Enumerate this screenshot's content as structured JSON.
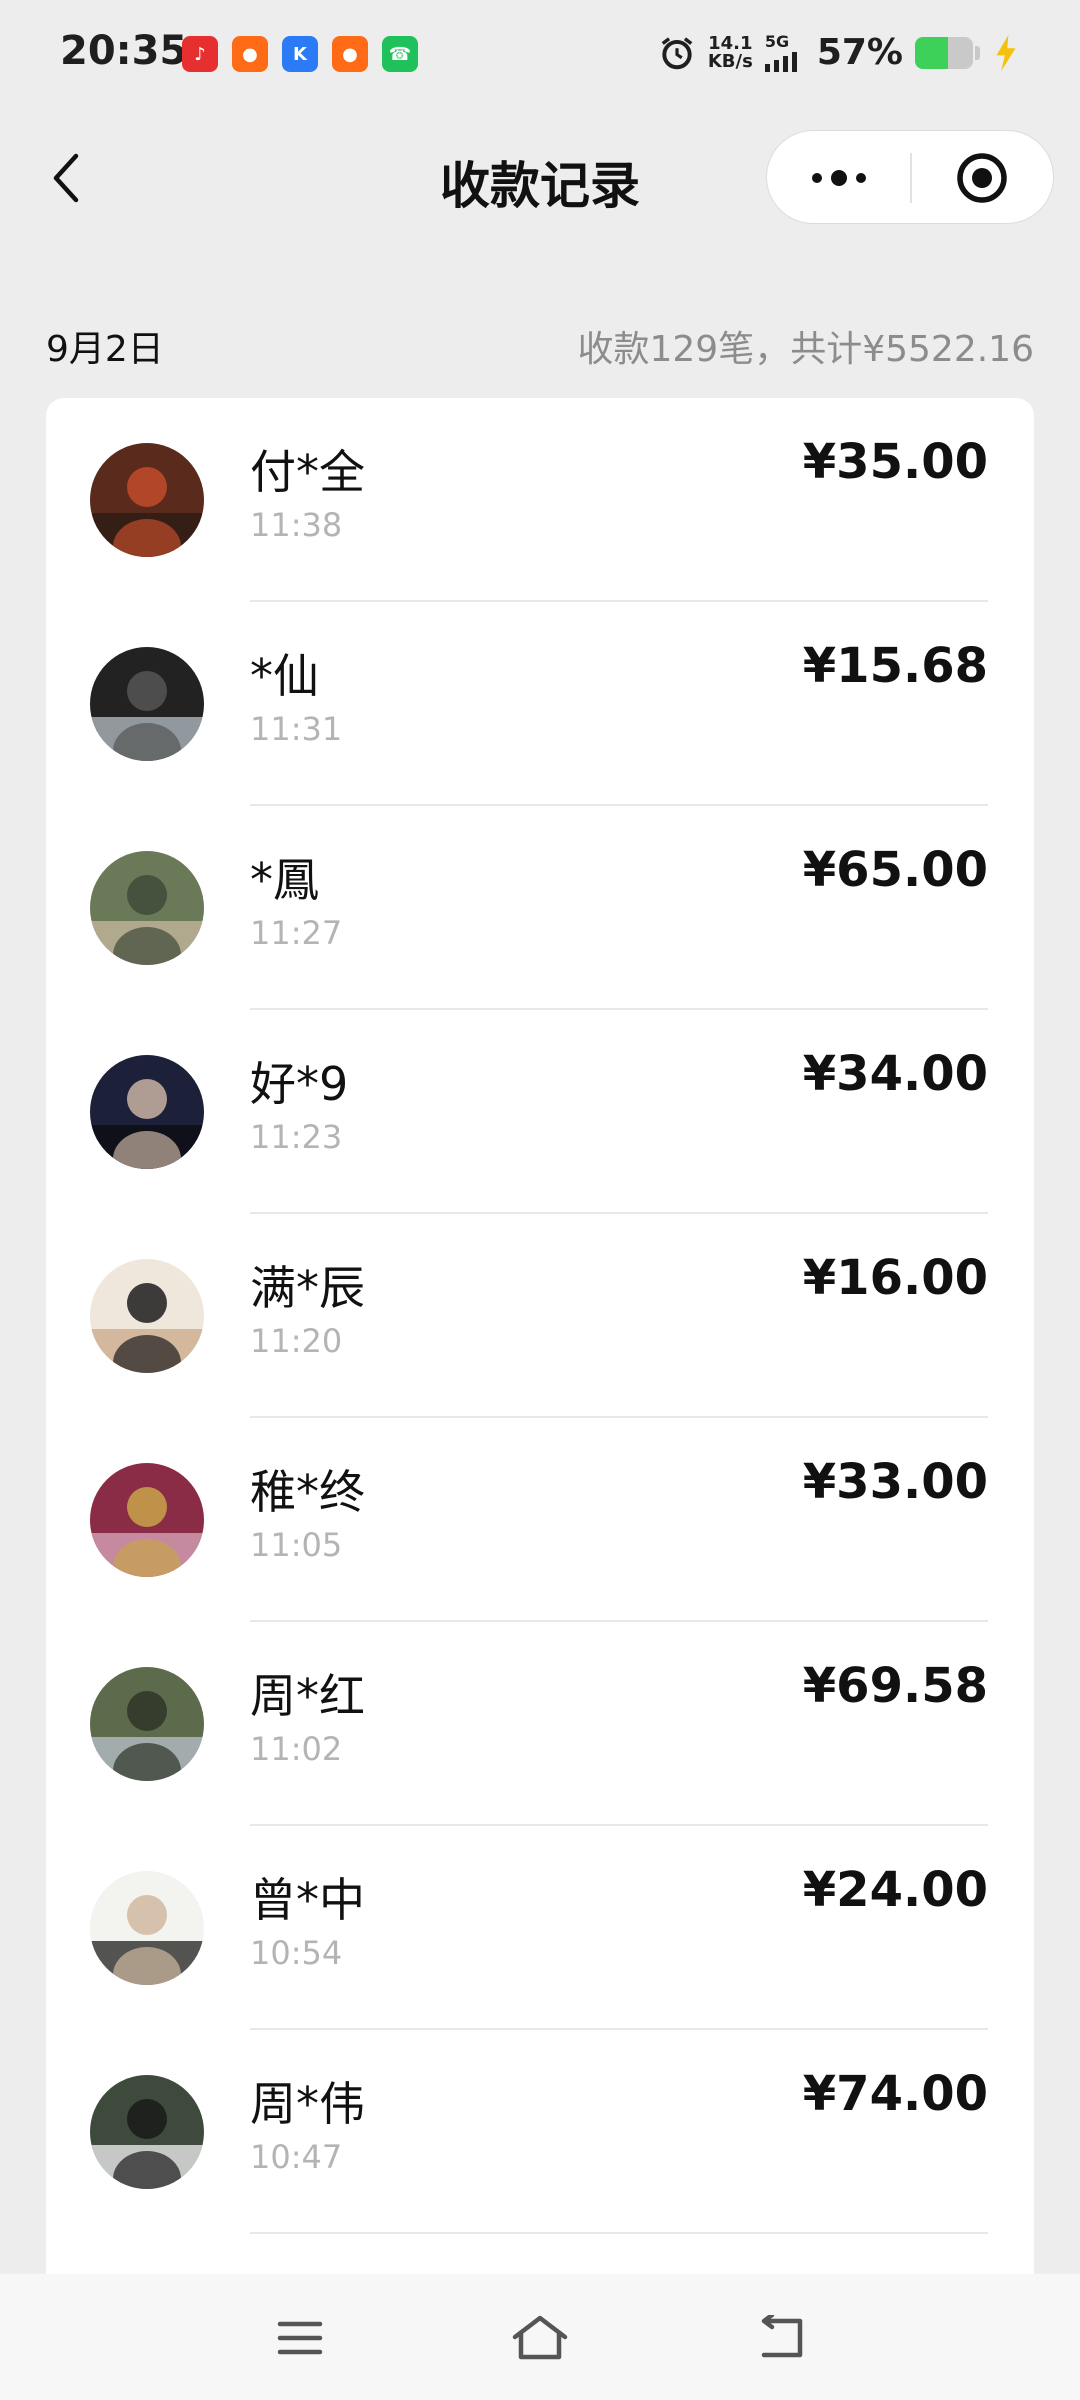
{
  "status_bar": {
    "time": "20:35",
    "net_speed_value": "14.1",
    "net_speed_unit": "KB/s",
    "network_type": "5G",
    "battery_percent": "57%",
    "battery_level": 0.57,
    "notification_icons": [
      {
        "name": "app-notification-icon-1",
        "color": "#e62f2f"
      },
      {
        "name": "app-notification-icon-2",
        "color": "#ff6a16"
      },
      {
        "name": "app-notification-icon-3",
        "color": "#2a7bf5"
      },
      {
        "name": "app-notification-icon-4",
        "color": "#ff6a16"
      },
      {
        "name": "phone-notification-icon",
        "color": "#1fc15b"
      }
    ]
  },
  "nav": {
    "title": "收款记录"
  },
  "summary": {
    "date": "9月2日",
    "total": "收款129笔，共计¥5522.16"
  },
  "records": [
    {
      "name": "付*全",
      "time": "11:38",
      "amount": "¥35.00",
      "avatar_colors": [
        "#5a2a1c",
        "#2a1b14",
        "#c14b2a"
      ]
    },
    {
      "name": "*仙",
      "time": "11:31",
      "amount": "¥15.68",
      "avatar_colors": [
        "#222222",
        "#b8c2c8",
        "#555555"
      ]
    },
    {
      "name": "*鳳",
      "time": "11:27",
      "amount": "¥65.00",
      "avatar_colors": [
        "#6a7a58",
        "#c9b9a0",
        "#3f4a3a"
      ]
    },
    {
      "name": "好*9",
      "time": "11:23",
      "amount": "¥34.00",
      "avatar_colors": [
        "#1c2038",
        "#0b0b10",
        "#c9b3a3"
      ]
    },
    {
      "name": "满*辰",
      "time": "11:20",
      "amount": "¥16.00",
      "avatar_colors": [
        "#efe6dc",
        "#caa88a",
        "#1c1c1c"
      ]
    },
    {
      "name": "稚*终",
      "time": "11:05",
      "amount": "¥33.00",
      "avatar_colors": [
        "#8a2c46",
        "#d8a9bf",
        "#c8a34a"
      ]
    },
    {
      "name": "周*红",
      "time": "11:02",
      "amount": "¥69.58",
      "avatar_colors": [
        "#5c6b4c",
        "#b9c2cc",
        "#2f3528"
      ]
    },
    {
      "name": "曾*中",
      "time": "10:54",
      "amount": "¥24.00",
      "avatar_colors": [
        "#f3f3f0",
        "#1e1e1e",
        "#d0b9a0"
      ]
    },
    {
      "name": "周*伟",
      "time": "10:47",
      "amount": "¥74.00",
      "avatar_colors": [
        "#3d4a3c",
        "#f3f3f3",
        "#1a1a1a"
      ]
    }
  ]
}
